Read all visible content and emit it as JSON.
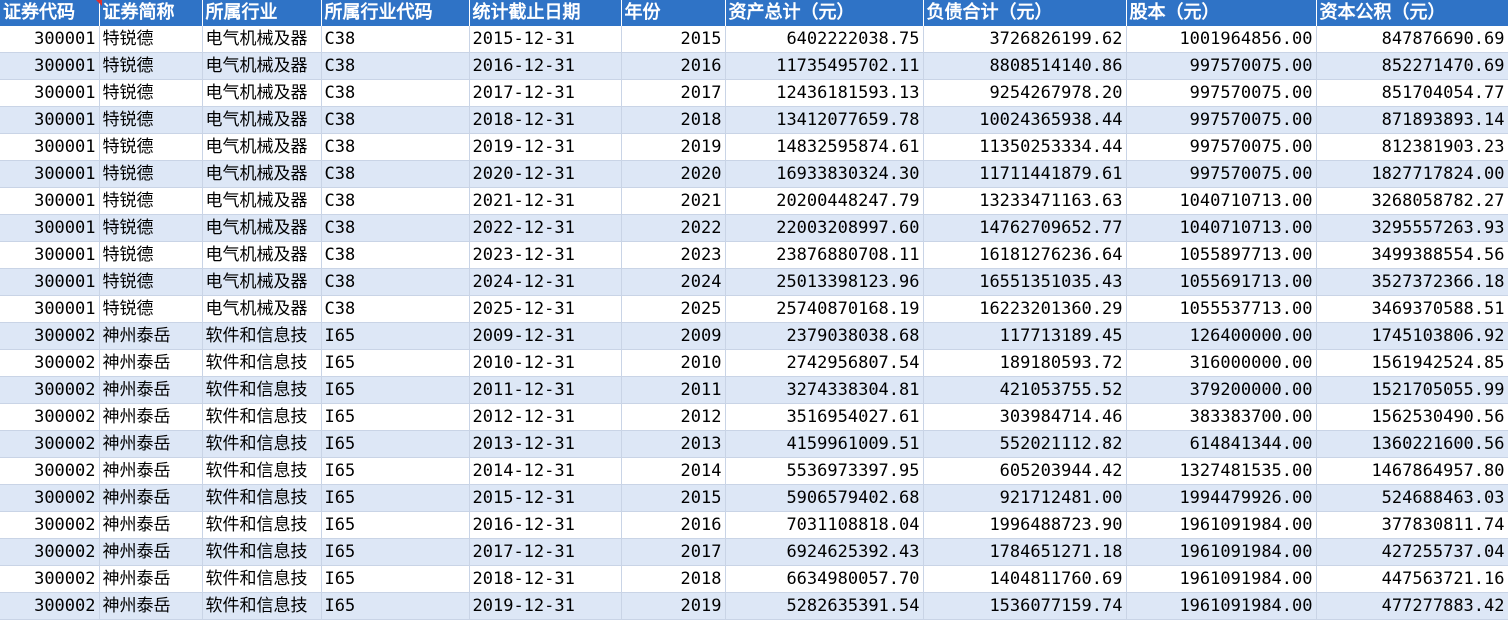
{
  "columns": [
    "证券代码",
    "证券简称",
    "所属行业",
    "所属行业代码",
    "统计截止日期",
    "年份",
    "资产总计（元）",
    "负债合计（元）",
    "股本（元）",
    "资本公积（元）"
  ],
  "rows": [
    [
      "300001",
      "特锐德",
      "电气机械及器",
      "C38",
      "2015-12-31",
      "2015",
      "6402222038.75",
      "3726826199.62",
      "1001964856.00",
      "847876690.69"
    ],
    [
      "300001",
      "特锐德",
      "电气机械及器",
      "C38",
      "2016-12-31",
      "2016",
      "11735495702.11",
      "8808514140.86",
      "997570075.00",
      "852271470.69"
    ],
    [
      "300001",
      "特锐德",
      "电气机械及器",
      "C38",
      "2017-12-31",
      "2017",
      "12436181593.13",
      "9254267978.20",
      "997570075.00",
      "851704054.77"
    ],
    [
      "300001",
      "特锐德",
      "电气机械及器",
      "C38",
      "2018-12-31",
      "2018",
      "13412077659.78",
      "10024365938.44",
      "997570075.00",
      "871893893.14"
    ],
    [
      "300001",
      "特锐德",
      "电气机械及器",
      "C38",
      "2019-12-31",
      "2019",
      "14832595874.61",
      "11350253334.44",
      "997570075.00",
      "812381903.23"
    ],
    [
      "300001",
      "特锐德",
      "电气机械及器",
      "C38",
      "2020-12-31",
      "2020",
      "16933830324.30",
      "11711441879.61",
      "997570075.00",
      "1827717824.00"
    ],
    [
      "300001",
      "特锐德",
      "电气机械及器",
      "C38",
      "2021-12-31",
      "2021",
      "20200448247.79",
      "13233471163.63",
      "1040710713.00",
      "3268058782.27"
    ],
    [
      "300001",
      "特锐德",
      "电气机械及器",
      "C38",
      "2022-12-31",
      "2022",
      "22003208997.60",
      "14762709652.77",
      "1040710713.00",
      "3295557263.93"
    ],
    [
      "300001",
      "特锐德",
      "电气机械及器",
      "C38",
      "2023-12-31",
      "2023",
      "23876880708.11",
      "16181276236.64",
      "1055897713.00",
      "3499388554.56"
    ],
    [
      "300001",
      "特锐德",
      "电气机械及器",
      "C38",
      "2024-12-31",
      "2024",
      "25013398123.96",
      "16551351035.43",
      "1055691713.00",
      "3527372366.18"
    ],
    [
      "300001",
      "特锐德",
      "电气机械及器",
      "C38",
      "2025-12-31",
      "2025",
      "25740870168.19",
      "16223201360.29",
      "1055537713.00",
      "3469370588.51"
    ],
    [
      "300002",
      "神州泰岳",
      "软件和信息技",
      "I65",
      "2009-12-31",
      "2009",
      "2379038038.68",
      "117713189.45",
      "126400000.00",
      "1745103806.92"
    ],
    [
      "300002",
      "神州泰岳",
      "软件和信息技",
      "I65",
      "2010-12-31",
      "2010",
      "2742956807.54",
      "189180593.72",
      "316000000.00",
      "1561942524.85"
    ],
    [
      "300002",
      "神州泰岳",
      "软件和信息技",
      "I65",
      "2011-12-31",
      "2011",
      "3274338304.81",
      "421053755.52",
      "379200000.00",
      "1521705055.99"
    ],
    [
      "300002",
      "神州泰岳",
      "软件和信息技",
      "I65",
      "2012-12-31",
      "2012",
      "3516954027.61",
      "303984714.46",
      "383383700.00",
      "1562530490.56"
    ],
    [
      "300002",
      "神州泰岳",
      "软件和信息技",
      "I65",
      "2013-12-31",
      "2013",
      "4159961009.51",
      "552021112.82",
      "614841344.00",
      "1360221600.56"
    ],
    [
      "300002",
      "神州泰岳",
      "软件和信息技",
      "I65",
      "2014-12-31",
      "2014",
      "5536973397.95",
      "605203944.42",
      "1327481535.00",
      "1467864957.80"
    ],
    [
      "300002",
      "神州泰岳",
      "软件和信息技",
      "I65",
      "2015-12-31",
      "2015",
      "5906579402.68",
      "921712481.00",
      "1994479926.00",
      "524688463.03"
    ],
    [
      "300002",
      "神州泰岳",
      "软件和信息技",
      "I65",
      "2016-12-31",
      "2016",
      "7031108818.04",
      "1996488723.90",
      "1961091984.00",
      "377830811.74"
    ],
    [
      "300002",
      "神州泰岳",
      "软件和信息技",
      "I65",
      "2017-12-31",
      "2017",
      "6924625392.43",
      "1784651271.18",
      "1961091984.00",
      "427255737.04"
    ],
    [
      "300002",
      "神州泰岳",
      "软件和信息技",
      "I65",
      "2018-12-31",
      "2018",
      "6634980057.70",
      "1404811760.69",
      "1961091984.00",
      "447563721.16"
    ],
    [
      "300002",
      "神州泰岳",
      "软件和信息技",
      "I65",
      "2019-12-31",
      "2019",
      "5282635391.54",
      "1536077159.74",
      "1961091984.00",
      "477277883.42"
    ]
  ]
}
